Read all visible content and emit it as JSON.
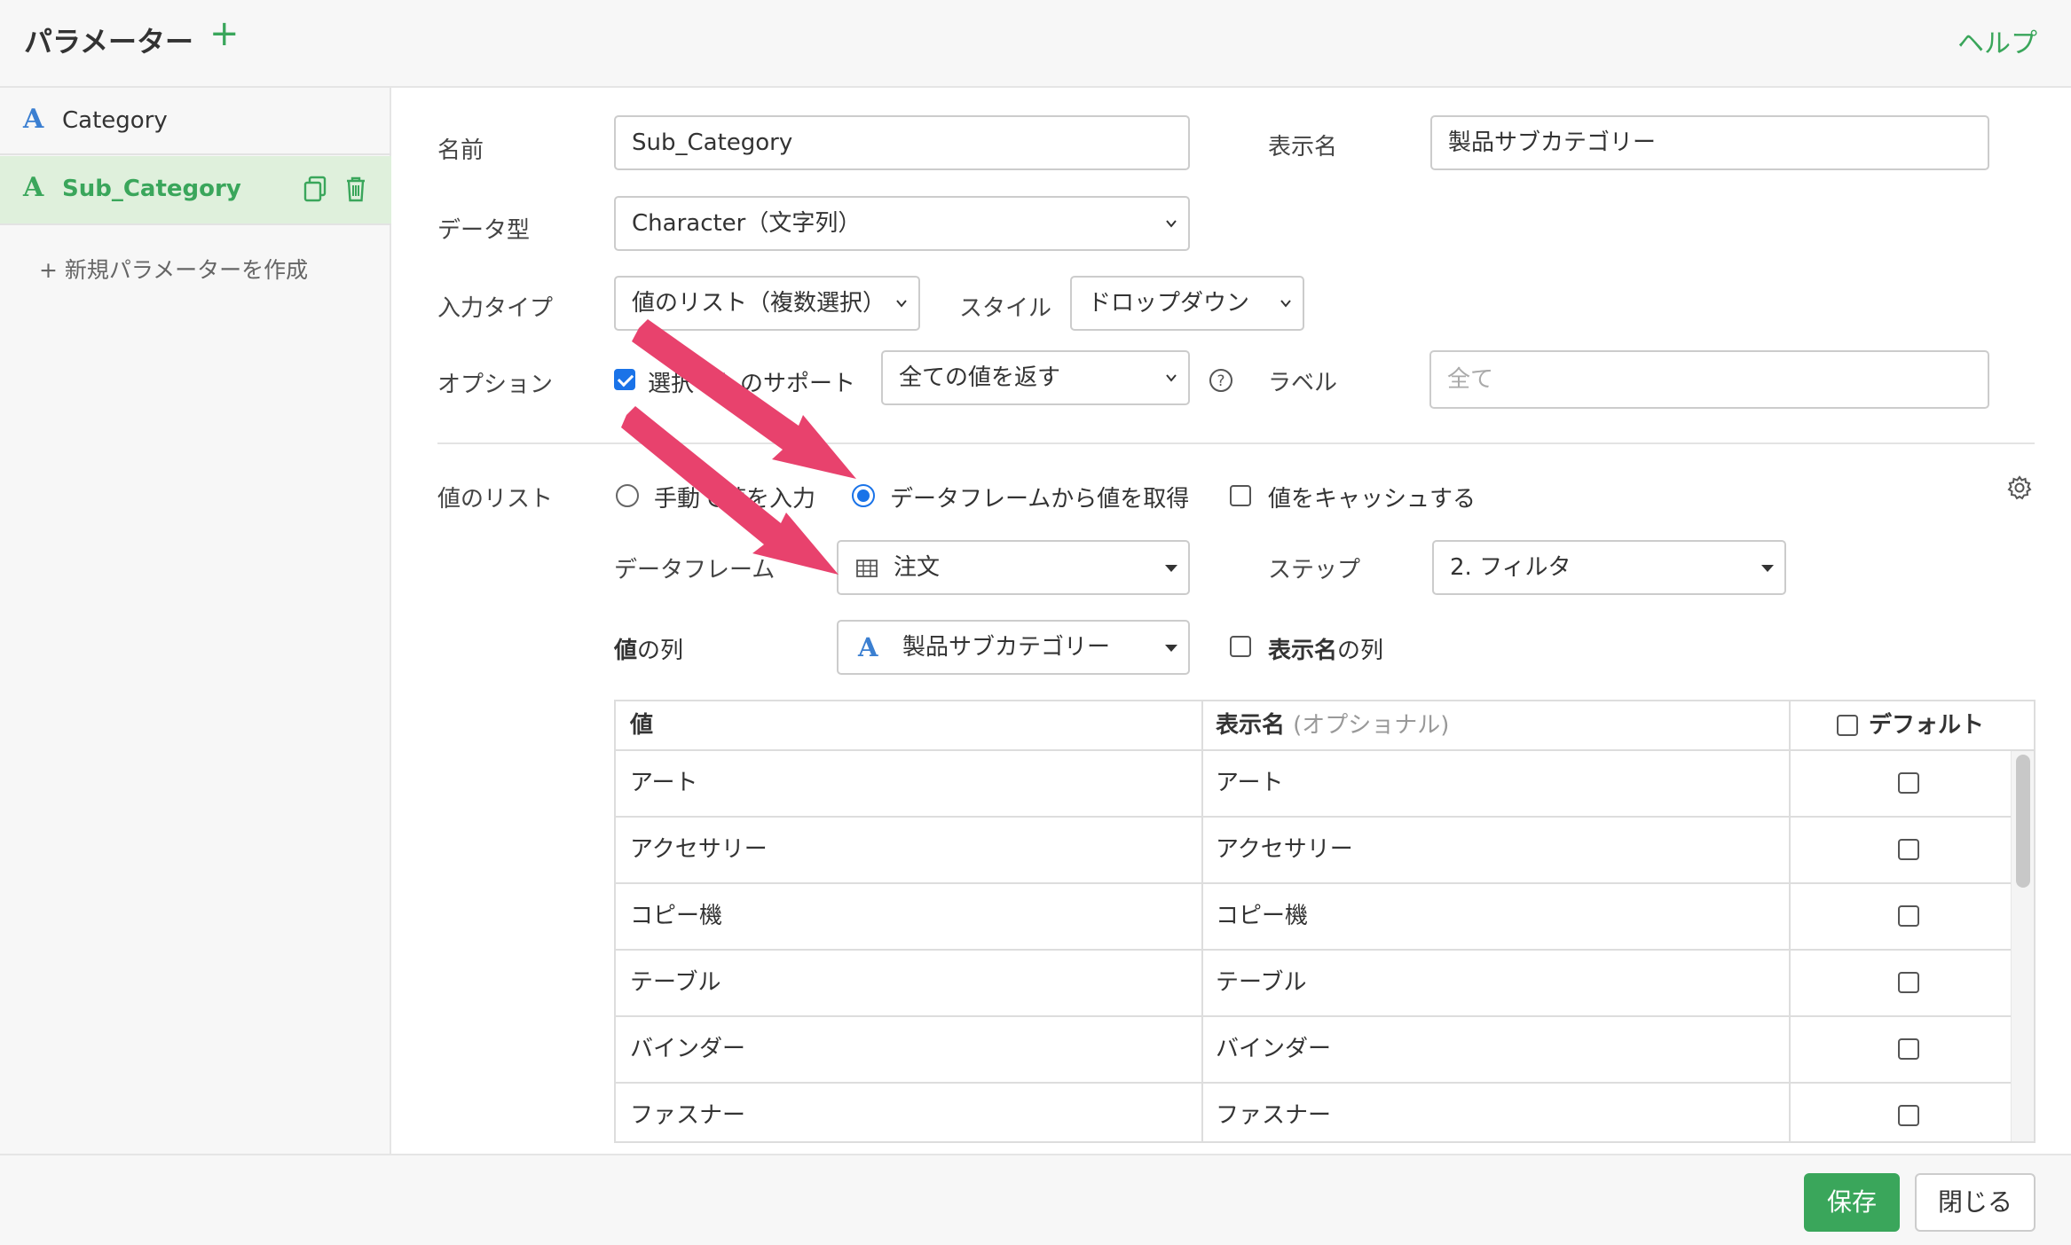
{
  "header": {
    "title": "パラメーター",
    "add_label": "+",
    "help": "ヘルプ"
  },
  "sidebar": {
    "items": [
      {
        "type_icon": "A",
        "label": "Category",
        "active": false
      },
      {
        "type_icon": "A",
        "label": "Sub_Category",
        "active": true
      }
    ],
    "new_param": "+ 新規パラメーターを作成"
  },
  "form": {
    "name_label": "名前",
    "name_value": "Sub_Category",
    "display_label": "表示名",
    "display_value": "製品サブカテゴリー",
    "datatype_label": "データ型",
    "datatype_value": "Character（文字列）",
    "input_type_label": "入力タイプ",
    "input_type_value": "値のリスト（複数選択）",
    "style_label": "スタイル",
    "style_value": "ドロップダウン",
    "option_label": "オプション",
    "option_checkbox_label": "選択なしのサポート",
    "option_select_value": "全ての値を返す",
    "help_icon": "?",
    "label_label": "ラベル",
    "label_placeholder": "全て"
  },
  "values": {
    "section_label": "値のリスト",
    "radio_manual": "手動で値を入力",
    "radio_dataframe": "データフレームから値を取得",
    "cache_label": "値をキャッシュする",
    "dataframe_label": "データフレーム",
    "dataframe_value": "注文",
    "step_label": "ステップ",
    "step_value": "2. フィルタ",
    "value_col_label_bold": "値",
    "value_col_label_rest": "の列",
    "value_col_value": "製品サブカテゴリー",
    "display_col_label_bold": "表示名",
    "display_col_label_rest": "の列"
  },
  "table": {
    "headers": {
      "value": "値",
      "display": "表示名",
      "display_sub": "(オプショナル)",
      "default": "デフォルト"
    },
    "rows": [
      {
        "value": "アート",
        "display": "アート"
      },
      {
        "value": "アクセサリー",
        "display": "アクセサリー"
      },
      {
        "value": "コピー機",
        "display": "コピー機"
      },
      {
        "value": "テーブル",
        "display": "テーブル"
      },
      {
        "value": "バインダー",
        "display": "バインダー"
      },
      {
        "value": "ファスナー",
        "display": "ファスナー"
      }
    ]
  },
  "footer": {
    "save": "保存",
    "close": "閉じる"
  },
  "colors": {
    "accent": "#3aa65b",
    "checkbox_blue": "#1a73e8",
    "arrow": "#e8426d",
    "type_icon": "#3b7fd1"
  }
}
